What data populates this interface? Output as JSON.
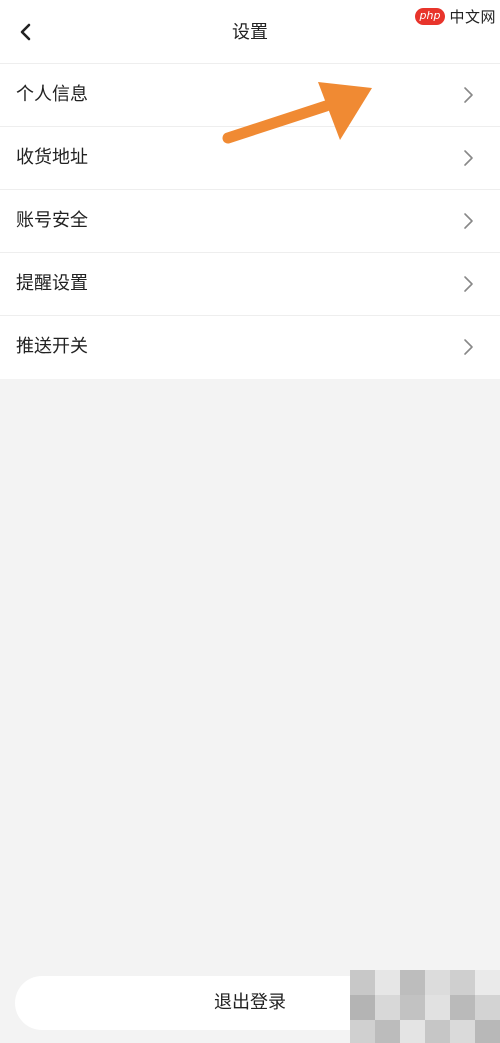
{
  "header": {
    "title": "设置",
    "back_icon": "chevron-left-icon"
  },
  "watermark": {
    "badge": "php",
    "text": "中文网"
  },
  "menu": {
    "items": [
      {
        "label": "个人信息",
        "icon": "chevron-right-icon"
      },
      {
        "label": "收货地址",
        "icon": "chevron-right-icon"
      },
      {
        "label": "账号安全",
        "icon": "chevron-right-icon"
      },
      {
        "label": "提醒设置",
        "icon": "chevron-right-icon"
      },
      {
        "label": "推送开关",
        "icon": "chevron-right-icon"
      }
    ]
  },
  "annotation": {
    "icon": "arrow-annotation-icon",
    "color": "#f08a33"
  },
  "footer": {
    "logout_label": "退出登录"
  },
  "colors": {
    "background": "#f3f3f3",
    "surface": "#ffffff",
    "text": "#222222",
    "divider": "#eeeeee",
    "chevron": "#888888"
  }
}
